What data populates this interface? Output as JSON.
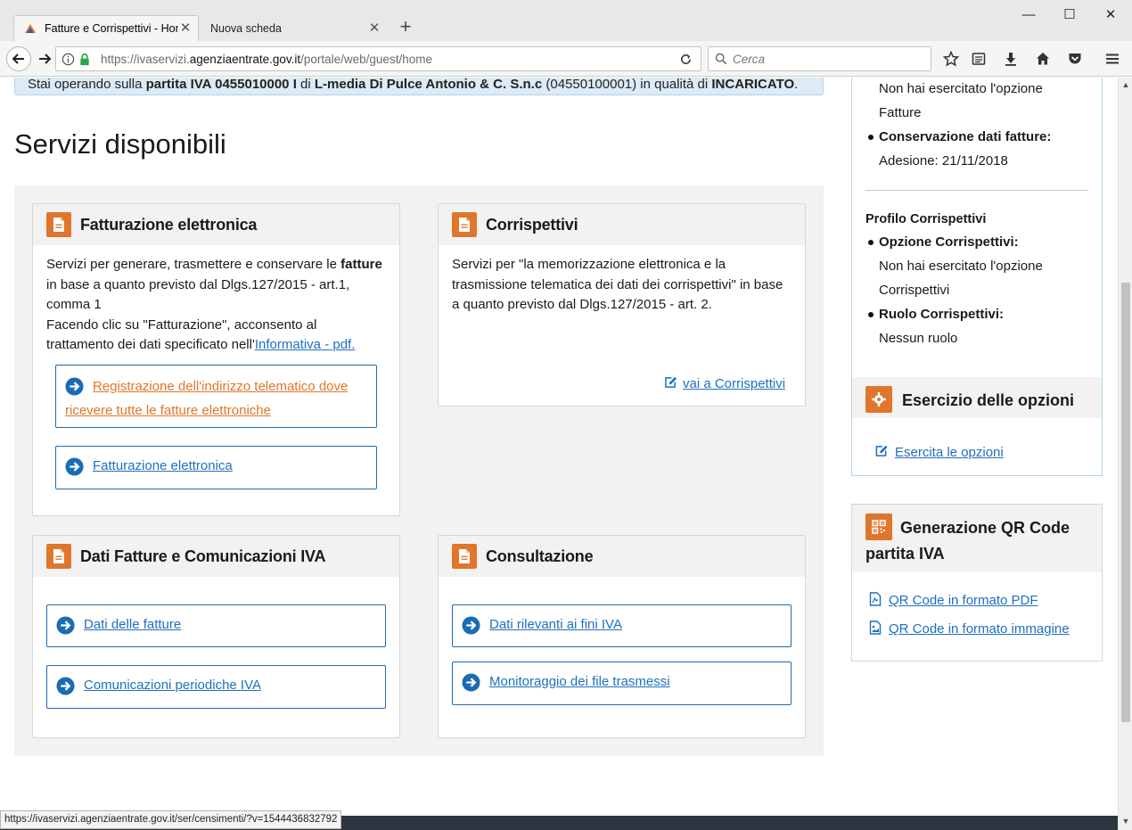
{
  "browser": {
    "tabs": [
      {
        "title": "Fatture e Corrispettivi - Home",
        "active": true
      },
      {
        "title": "Nuova scheda",
        "active": false
      }
    ],
    "url_prefix": "https://ivaservizi.",
    "url_domain": "agenziaentrate.gov.it",
    "url_path": "/portale/web/guest/home",
    "search_placeholder": "Cerca",
    "status_url": "https://ivaservizi.agenziaentrate.gov.it/ser/censimenti/?v=1544436832792"
  },
  "notice": {
    "text_prefix": "Stai operando sulla ",
    "partita_label": "partita IVA 0455010000 I",
    "mid": " di ",
    "company": "L-media Di Pulce Antonio & C. S.n.c",
    "cf": " (04550100001) in qualità di ",
    "role": "INCARICATO",
    "end": "."
  },
  "page_title": "Servizi disponibili",
  "cards": {
    "fatturazione": {
      "title": "Fatturazione elettronica",
      "desc_1": "Servizi per generare, trasmettere e conservare le ",
      "desc_bold": "fatture",
      "desc_2": "in base a quanto previsto dal Dlgs.127/2015 - art.1,",
      "desc_3": "comma 1",
      "desc_4": "Facendo clic su \"Fatturazione\", acconsento al",
      "desc_5": "trattamento dei dati specificato nell'",
      "info_link": "Informativa - pdf.",
      "btn_registrazione_1": "Registrazione dell'indirizzo telematico dove",
      "btn_registrazione_2": "ricevere tutte le fatture elettroniche",
      "btn_fatturazione": "Fatturazione elettronica"
    },
    "corrispettivi": {
      "title": "Corrispettivi",
      "desc_1": "Servizi per \"la memorizzazione elettronica e la",
      "desc_2": "trasmissione telematica dei dati dei corrispettivi\" in base",
      "desc_3": "a quanto previsto dal Dlgs.127/2015 - art. 2.",
      "link": "vai a Corrispettivi"
    },
    "dati_fatture": {
      "title": "Dati Fatture e Comunicazioni IVA",
      "btn_dati": "Dati delle fatture",
      "btn_comunicazioni": "Comunicazioni periodiche IVA"
    },
    "consultazione": {
      "title": "Consultazione",
      "btn_dati_rilevanti": "Dati rilevanti ai fini IVA",
      "btn_monitoraggio": "Monitoraggio dei file trasmessi"
    }
  },
  "sidebar": {
    "fatture_opzione_1": "Non hai esercitato l'opzione",
    "fatture_opzione_2": "Fatture",
    "conservazione_label": "Conservazione dati fatture:",
    "conservazione_value": "Adesione: 21/11/2018",
    "profilo_corrispettivi": "Profilo Corrispettivi",
    "opzione_corr_label": "Opzione Corrispettivi:",
    "opzione_corr_1": "Non hai esercitato l'opzione",
    "opzione_corr_2": "Corrispettivi",
    "ruolo_label": "Ruolo Corrispettivi:",
    "ruolo_value": "Nessun ruolo",
    "esercizio_title": "Esercizio delle opzioni",
    "esercita_link": "Esercita le opzioni",
    "qr_title_1": "Generazione QR Code",
    "qr_title_2": "partita IVA",
    "qr_pdf": "QR Code in formato PDF",
    "qr_img": "QR Code in formato immagine"
  },
  "colors": {
    "accent_orange": "#e0762b",
    "link_blue": "#1f6fbf",
    "button_border": "#1a6cb3"
  }
}
